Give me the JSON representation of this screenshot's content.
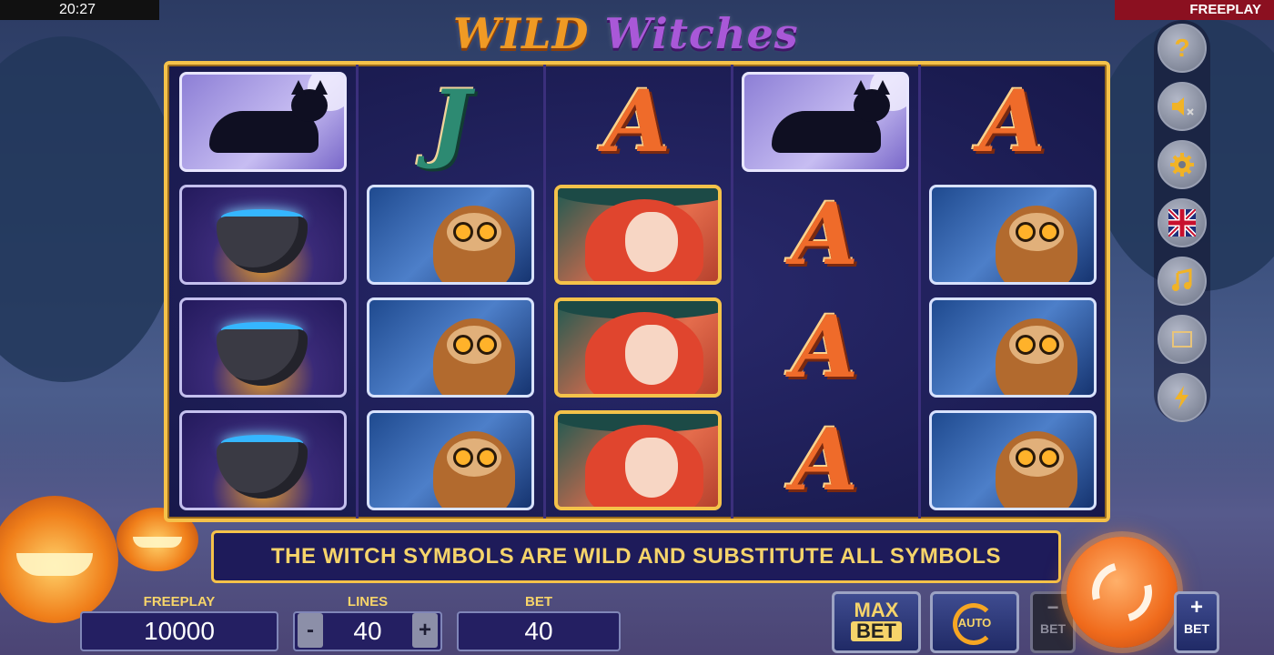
{
  "status_bar": {
    "time": "20:27",
    "mode": "FREEPLAY"
  },
  "game": {
    "title_part1": "WILD",
    "title_part2": "Witches"
  },
  "reels": [
    [
      "cat",
      "pot",
      "pot",
      "pot"
    ],
    [
      "J",
      "owl",
      "owl",
      "owl"
    ],
    [
      "A",
      "witch",
      "witch",
      "witch"
    ],
    [
      "cat",
      "A",
      "A",
      "A"
    ],
    [
      "A",
      "owl",
      "owl",
      "owl"
    ]
  ],
  "info_message": "THE WITCH SYMBOLS ARE WILD AND SUBSTITUTE ALL SYMBOLS",
  "side_menu": {
    "items": [
      "help-icon",
      "sound-muted-icon",
      "settings-icon",
      "language-uk-flag-icon",
      "music-icon",
      "fullscreen-icon",
      "turbo-lightning-icon"
    ]
  },
  "bottom": {
    "freeplay_label": "FREEPLAY",
    "freeplay_value": "10000",
    "lines_label": "LINES",
    "lines_value": "40",
    "lines_minus": "-",
    "lines_plus": "+",
    "bet_label": "BET",
    "bet_value": "40",
    "maxbet_top": "MAX",
    "maxbet_bottom": "BET",
    "auto_label": "AUTO",
    "bet_minus_sign": "−",
    "bet_minus_label": "BET",
    "bet_plus_sign": "+",
    "bet_plus_label": "BET"
  },
  "colors": {
    "frame_gold": "#f5c24a",
    "panel_navy": "#241f62",
    "text_gold": "#f6d46a",
    "spin_orange": "#f06b1c"
  }
}
